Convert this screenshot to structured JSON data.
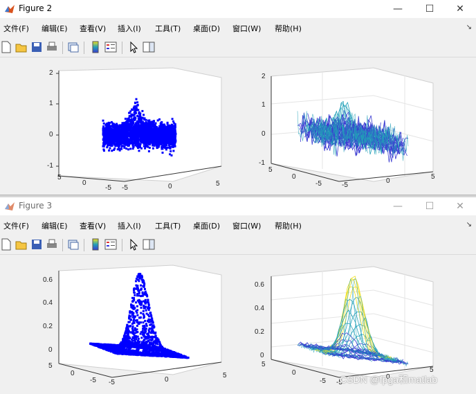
{
  "figure2": {
    "title": "Figure 2",
    "menu": [
      "文件(F)",
      "编辑(E)",
      "查看(V)",
      "插入(I)",
      "工具(T)",
      "桌面(D)",
      "窗口(W)",
      "帮助(H)"
    ],
    "plot_left_ticks": {
      "z": [
        "2",
        "1",
        "0",
        "-1"
      ],
      "y": [
        "5",
        "0",
        "-5"
      ],
      "x": [
        "-5",
        "0",
        "5"
      ]
    },
    "plot_right_ticks": {
      "z": [
        "2",
        "1",
        "0",
        "-1"
      ],
      "y": [
        "5",
        "0",
        "-5"
      ],
      "x": [
        "-5",
        "0",
        "5"
      ]
    }
  },
  "figure3": {
    "title": "Figure 3",
    "menu": [
      "文件(F)",
      "编辑(E)",
      "查看(V)",
      "插入(I)",
      "工具(T)",
      "桌面(D)",
      "窗口(W)",
      "帮助(H)"
    ],
    "plot_left_ticks": {
      "z": [
        "0.6",
        "0.4",
        "0.2",
        "0"
      ],
      "y": [
        "5",
        "0",
        "-5"
      ],
      "x": [
        "-5",
        "0",
        "5"
      ]
    },
    "plot_right_ticks": {
      "z": [
        "0.6",
        "0.4",
        "0.2",
        "0"
      ],
      "y": [
        "5",
        "0",
        "-5"
      ],
      "x": [
        "-5",
        "0",
        "5"
      ]
    }
  },
  "watermark": "CSDN @fpga和matlab",
  "colors": {
    "scatter": "#0000ff",
    "mesh_low": "#3b3bd1",
    "mesh_mid": "#22a0b8",
    "mesh_high": "#f0e020"
  }
}
